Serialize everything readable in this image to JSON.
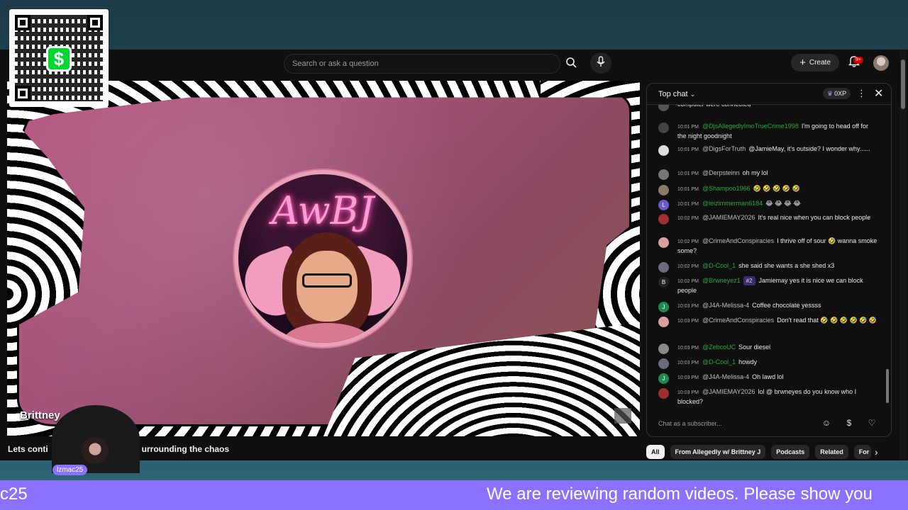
{
  "header": {
    "search_placeholder": "Search or ask a question",
    "create_label": "Create",
    "notif_badge": "9+"
  },
  "video": {
    "logo_text": "AwBJ",
    "watermark": "Brittney"
  },
  "stream": {
    "title_left": "Lets conti",
    "title_right": "urrounding the chaos",
    "host_badge": "lzmac25"
  },
  "chat": {
    "header_title": "Top chat",
    "xp": "0XP",
    "input_placeholder": "Chat as a subscriber...",
    "accent_color": "#2ba640",
    "messages": [
      {
        "time": "",
        "user": "",
        "text": "computer were connected",
        "av": "#555"
      },
      {
        "time": "10:01 PM",
        "user": "@DjsAllegedlyImoTrueCrime1998",
        "mod": true,
        "text": "I'm going to head off for the night goodnight",
        "av": "#444"
      },
      {
        "time": "10:01 PM",
        "user": "@DigsForTruth",
        "mod": false,
        "text": "@JamieMay, it's outside? I wonder why......",
        "av": "#ddd"
      },
      {
        "time": "10:01 PM",
        "user": "@Derpsteinn",
        "mod": false,
        "text": "oh my lol",
        "av": "#777"
      },
      {
        "time": "10:01 PM",
        "user": "@Shampoo1966",
        "mod": true,
        "text": "🤣 🤣 🤣 🤣 🤣",
        "av": "#8a7a66"
      },
      {
        "time": "10:01 PM",
        "user": "@leizimmerman6184",
        "mod": true,
        "text": "😂 😂 😂 😂",
        "av": "#6a5acd",
        "letter": "L"
      },
      {
        "time": "10:02 PM",
        "user": "@JAMIEMAY2026",
        "mod": false,
        "text": "It's real nice when you can block people",
        "av": "#a03030"
      },
      {
        "time": "10:02 PM",
        "user": "@CrimeAndConspiracies",
        "mod": false,
        "text": "I thrive off of sour 🤣 wanna smoke some?",
        "av": "#d8a0a0"
      },
      {
        "time": "10:02 PM",
        "user": "@D-Cool_1",
        "mod": true,
        "text": "she said she wants a she shed x3",
        "av": "#6b6b7a"
      },
      {
        "time": "10:02 PM",
        "user": "@Brwneyez1",
        "mod": true,
        "rank": "#2",
        "text": "Jamiemay yes it is nice we can block people",
        "av": "#222",
        "letter": "B"
      },
      {
        "time": "10:03 PM",
        "user": "@J4A-Melissa-4",
        "mod": false,
        "text": "Coffee chocolate yessss",
        "av": "#1e8a50",
        "letter": "J"
      },
      {
        "time": "10:03 PM",
        "user": "@CrimeAndConspiracies",
        "mod": false,
        "text": "Don't read that 🤣 🤣 🤣 🤣 🤣 🤣",
        "av": "#d8a0a0"
      },
      {
        "time": "10:03 PM",
        "user": "@ZebcoUC",
        "mod": true,
        "text": "Sour diesel",
        "av": "#888"
      },
      {
        "time": "10:03 PM",
        "user": "@D-Cool_1",
        "mod": true,
        "text": "howdy",
        "av": "#6b6b7a"
      },
      {
        "time": "10:03 PM",
        "user": "@J4A-Melissa-4",
        "mod": false,
        "text": "Oh lawd lol",
        "av": "#1e8a50",
        "letter": "J"
      },
      {
        "time": "10:03 PM",
        "user": "@JAMIEMAY2026",
        "mod": false,
        "text": "lol @ brwneyes do you know who I blocked?",
        "av": "#a03030"
      }
    ]
  },
  "chips": [
    "All",
    "From Allegedly w/ Brittney J",
    "Podcasts",
    "Related",
    "For"
  ],
  "ticker": {
    "left": "c25",
    "main": "We are reviewing random videos. Please show you"
  },
  "qr": {
    "brand_symbol": "$",
    "brand_color": "#00d632"
  }
}
